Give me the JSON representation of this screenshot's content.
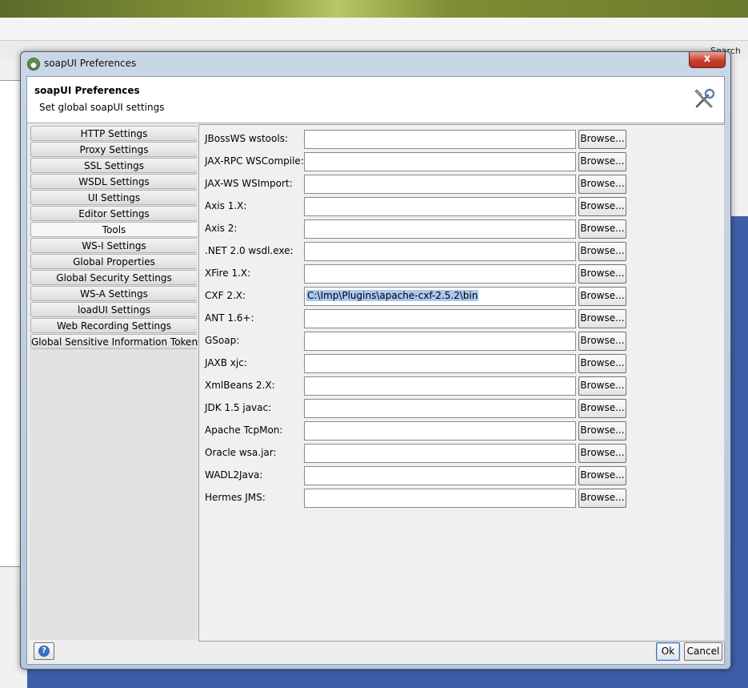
{
  "background": {
    "search_label": "Search F"
  },
  "dialog": {
    "title": "soapUI Preferences",
    "close_label": "x",
    "header_title": "soapUI Preferences",
    "header_subtitle": "Set global soapUI settings",
    "header_icon": "tools-icon"
  },
  "tabs": [
    {
      "label": "HTTP Settings"
    },
    {
      "label": "Proxy Settings"
    },
    {
      "label": "SSL Settings"
    },
    {
      "label": "WSDL Settings"
    },
    {
      "label": "UI Settings"
    },
    {
      "label": "Editor Settings"
    },
    {
      "label": "Tools",
      "active": true
    },
    {
      "label": "WS-I Settings"
    },
    {
      "label": "Global Properties"
    },
    {
      "label": "Global Security Settings"
    },
    {
      "label": "WS-A Settings"
    },
    {
      "label": "loadUI Settings"
    },
    {
      "label": "Web Recording Settings"
    },
    {
      "label": "Global Sensitive Information Tokens"
    }
  ],
  "tools": [
    {
      "label": "JBossWS wstools:",
      "value": "",
      "browse": "Browse..."
    },
    {
      "label": "JAX-RPC WSCompile:",
      "value": "",
      "browse": "Browse..."
    },
    {
      "label": "JAX-WS WSImport:",
      "value": "",
      "browse": "Browse..."
    },
    {
      "label": "Axis 1.X:",
      "value": "",
      "browse": "Browse..."
    },
    {
      "label": "Axis 2:",
      "value": "",
      "browse": "Browse..."
    },
    {
      "label": ".NET 2.0 wsdl.exe:",
      "value": "",
      "browse": "Browse..."
    },
    {
      "label": "XFire 1.X:",
      "value": "",
      "browse": "Browse..."
    },
    {
      "label": "CXF 2.X:",
      "value": "C:\\Imp\\Plugins\\apache-cxf-2.5.2\\bin",
      "browse": "Browse...",
      "selected": true
    },
    {
      "label": "ANT 1.6+:",
      "value": "",
      "browse": "Browse..."
    },
    {
      "label": "GSoap:",
      "value": "",
      "browse": "Browse..."
    },
    {
      "label": "JAXB xjc:",
      "value": "",
      "browse": "Browse..."
    },
    {
      "label": "XmlBeans 2.X:",
      "value": "",
      "browse": "Browse..."
    },
    {
      "label": "JDK 1.5 javac:",
      "value": "",
      "browse": "Browse..."
    },
    {
      "label": "Apache TcpMon:",
      "value": "",
      "browse": "Browse..."
    },
    {
      "label": "Oracle wsa.jar:",
      "value": "",
      "browse": "Browse..."
    },
    {
      "label": "WADL2Java:",
      "value": "",
      "browse": "Browse..."
    },
    {
      "label": "Hermes JMS:",
      "value": "",
      "browse": "Browse..."
    }
  ],
  "footer": {
    "help_icon": "help-icon",
    "help_glyph": "?",
    "ok_label": "Ok",
    "cancel_label": "Cancel"
  }
}
